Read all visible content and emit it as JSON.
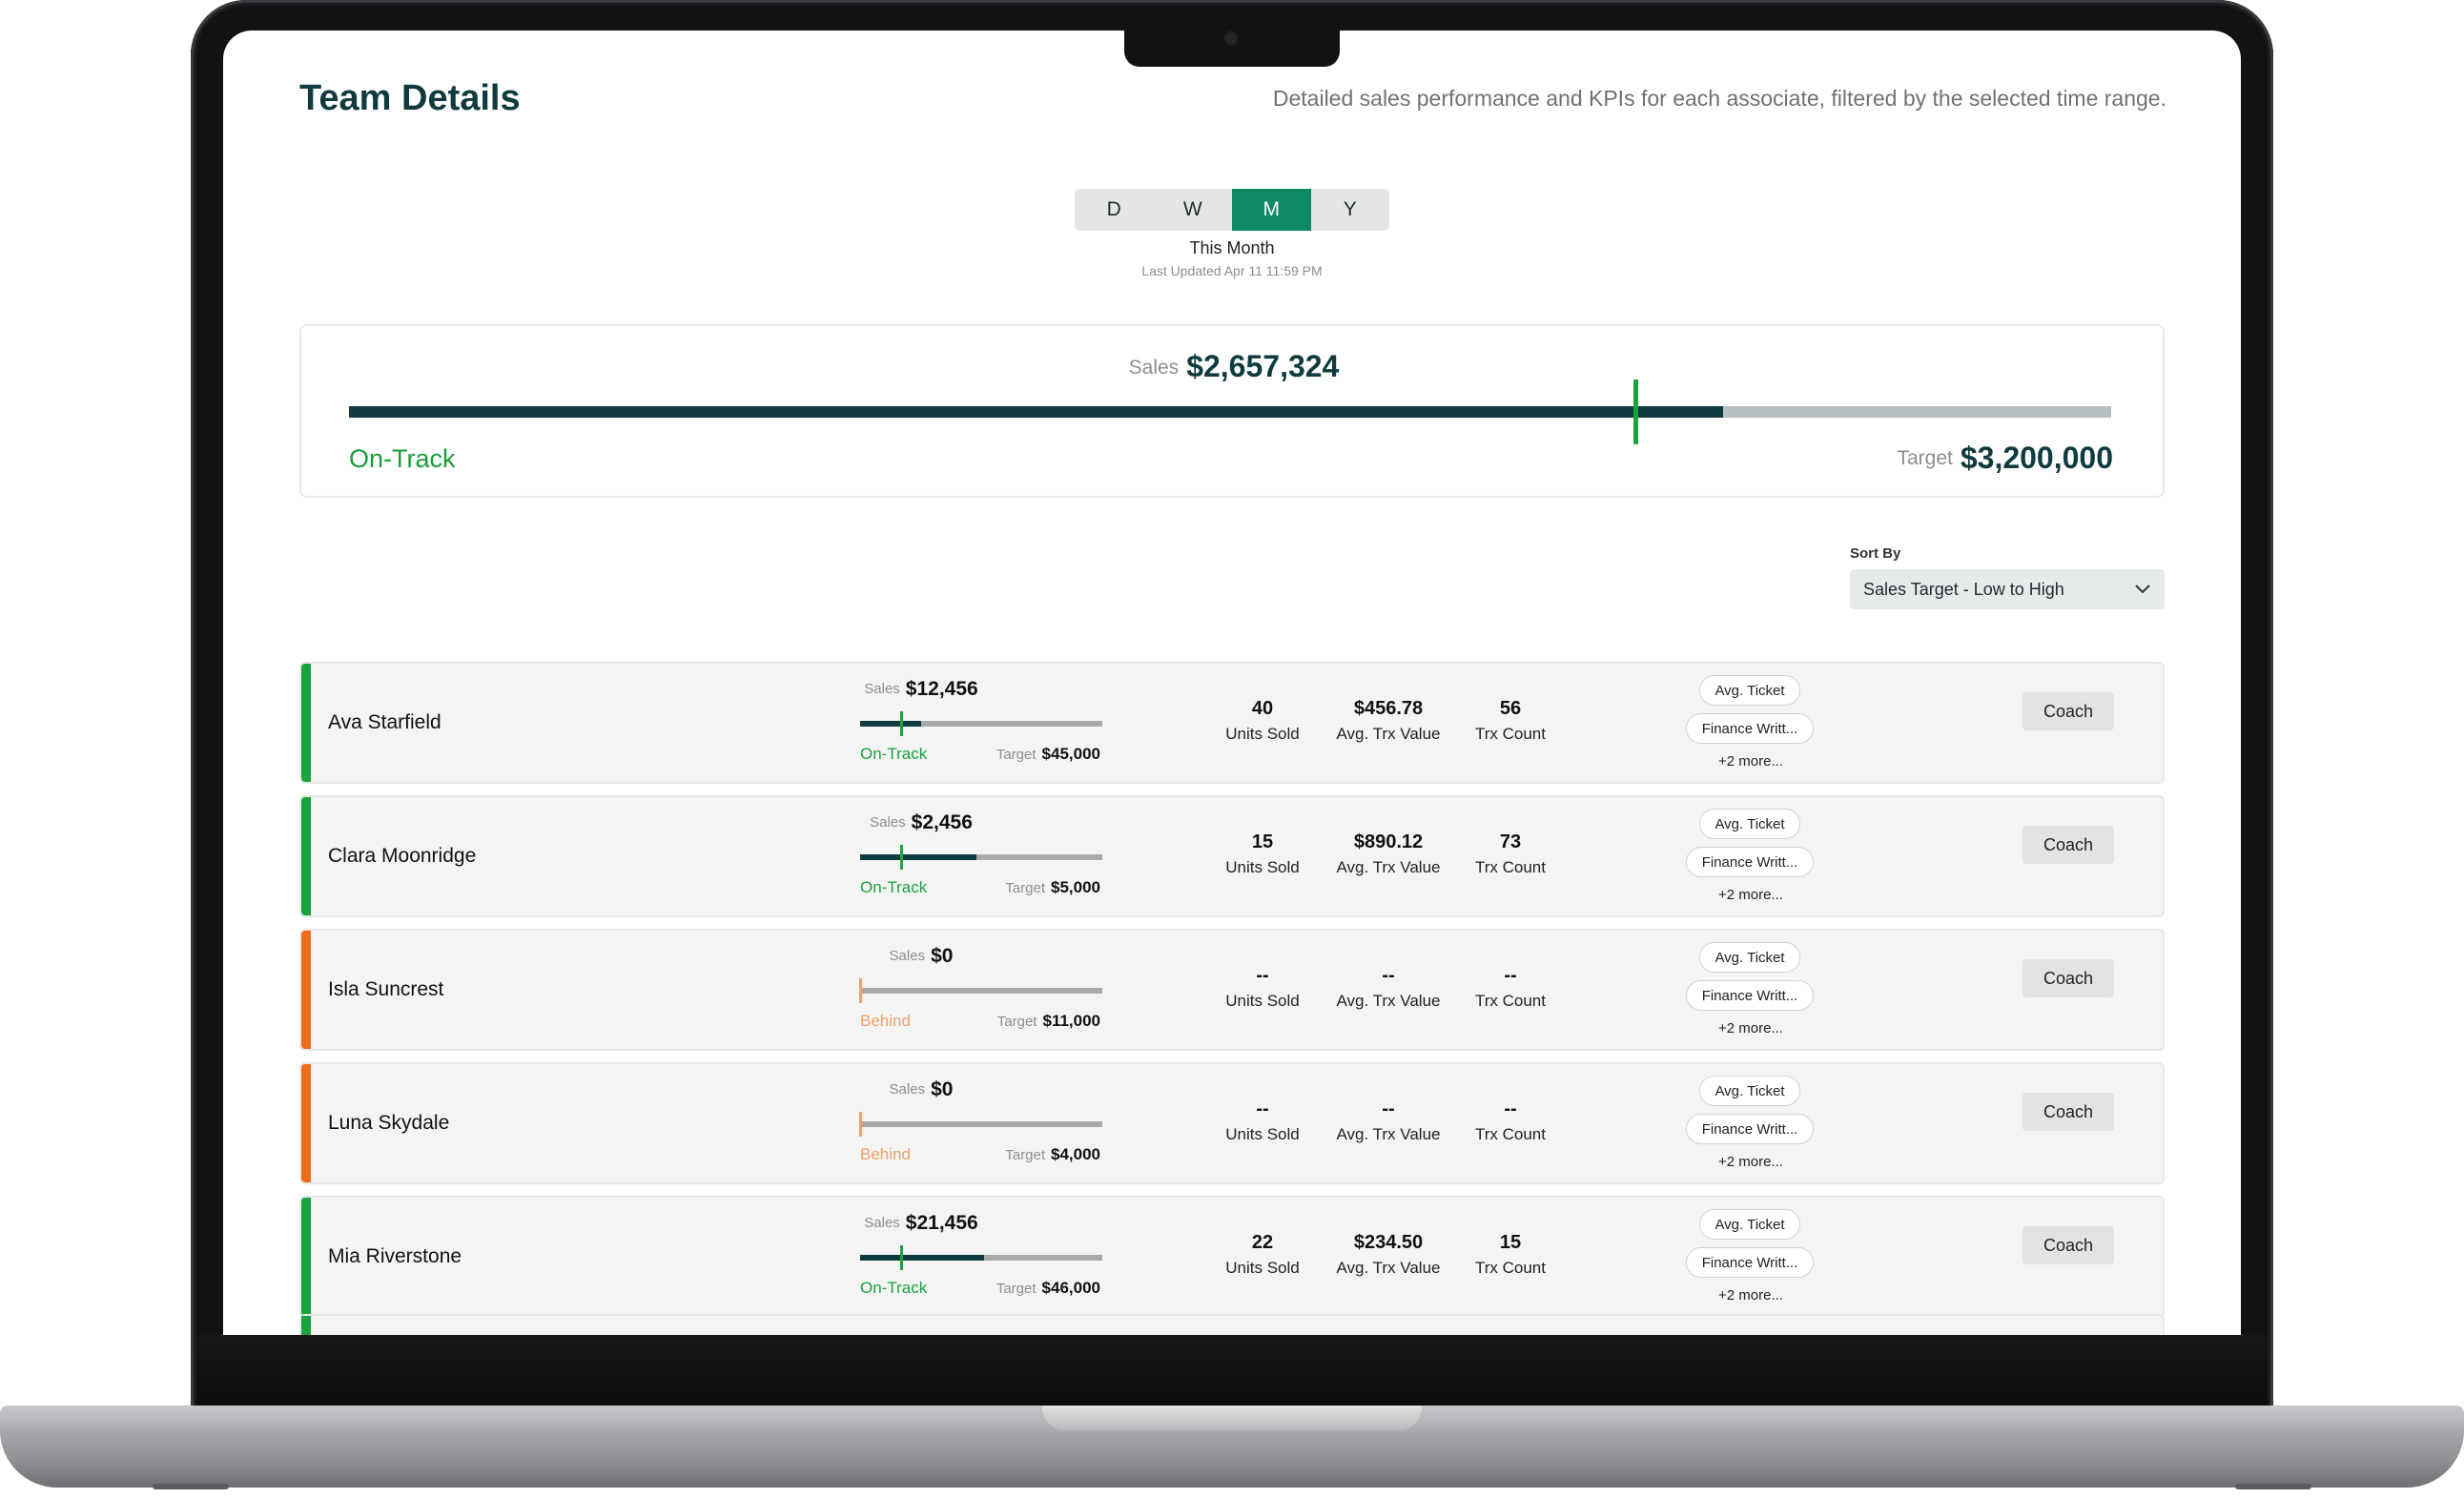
{
  "header": {
    "title": "Team Details",
    "subtitle": "Detailed sales performance and KPIs for each associate, filtered by the selected time range."
  },
  "time_range": {
    "options": [
      "D",
      "W",
      "M",
      "Y"
    ],
    "selected": "M",
    "label": "This Month",
    "last_updated": "Last Updated  Apr 11  11:59 PM"
  },
  "summary": {
    "sales_label": "Sales",
    "sales_value": "$2,657,324",
    "status": "On-Track",
    "target_label": "Target",
    "target_value": "$3,200,000",
    "progress_fraction": 0.78,
    "pace_marker_fraction": 0.73
  },
  "sort": {
    "label": "Sort By",
    "selected": "Sales Target - Low to High"
  },
  "labels": {
    "sales": "Sales",
    "target": "Target",
    "units_sold": "Units Sold",
    "avg_trx_value": "Avg. Trx Value",
    "trx_count": "Trx Count",
    "pill_avg_ticket": "Avg. Ticket",
    "pill_finance": "Finance Writt...",
    "more": "+2 more...",
    "coach": "Coach"
  },
  "colors": {
    "on_track": "#1aa33b",
    "behind": "#f26b1d",
    "behind_text": "#f0a06a",
    "brand_dark": "#0f3b3f",
    "accent": "#0b8a64"
  },
  "associates": [
    {
      "name": "Ava Starfield",
      "sales": "$12,456",
      "target": "$45,000",
      "status": "On-Track",
      "status_type": "on_track",
      "progress": 0.25,
      "marker": 0.17,
      "units_sold": "40",
      "avg_trx_value": "$456.78",
      "trx_count": "56"
    },
    {
      "name": "Clara Moonridge",
      "sales": "$2,456",
      "target": "$5,000",
      "status": "On-Track",
      "status_type": "on_track",
      "progress": 0.48,
      "marker": 0.17,
      "units_sold": "15",
      "avg_trx_value": "$890.12",
      "trx_count": "73"
    },
    {
      "name": "Isla Suncrest",
      "sales": "$0",
      "target": "$11,000",
      "status": "Behind",
      "status_type": "behind",
      "progress": 0,
      "marker": 0.0,
      "units_sold": "--",
      "avg_trx_value": "--",
      "trx_count": "--"
    },
    {
      "name": "Luna Skydale",
      "sales": "$0",
      "target": "$4,000",
      "status": "Behind",
      "status_type": "behind",
      "progress": 0,
      "marker": 0.0,
      "units_sold": "--",
      "avg_trx_value": "--",
      "trx_count": "--"
    },
    {
      "name": "Mia Riverstone",
      "sales": "$21,456",
      "target": "$46,000",
      "status": "On-Track",
      "status_type": "on_track",
      "progress": 0.51,
      "marker": 0.17,
      "units_sold": "22",
      "avg_trx_value": "$234.50",
      "trx_count": "15"
    }
  ]
}
